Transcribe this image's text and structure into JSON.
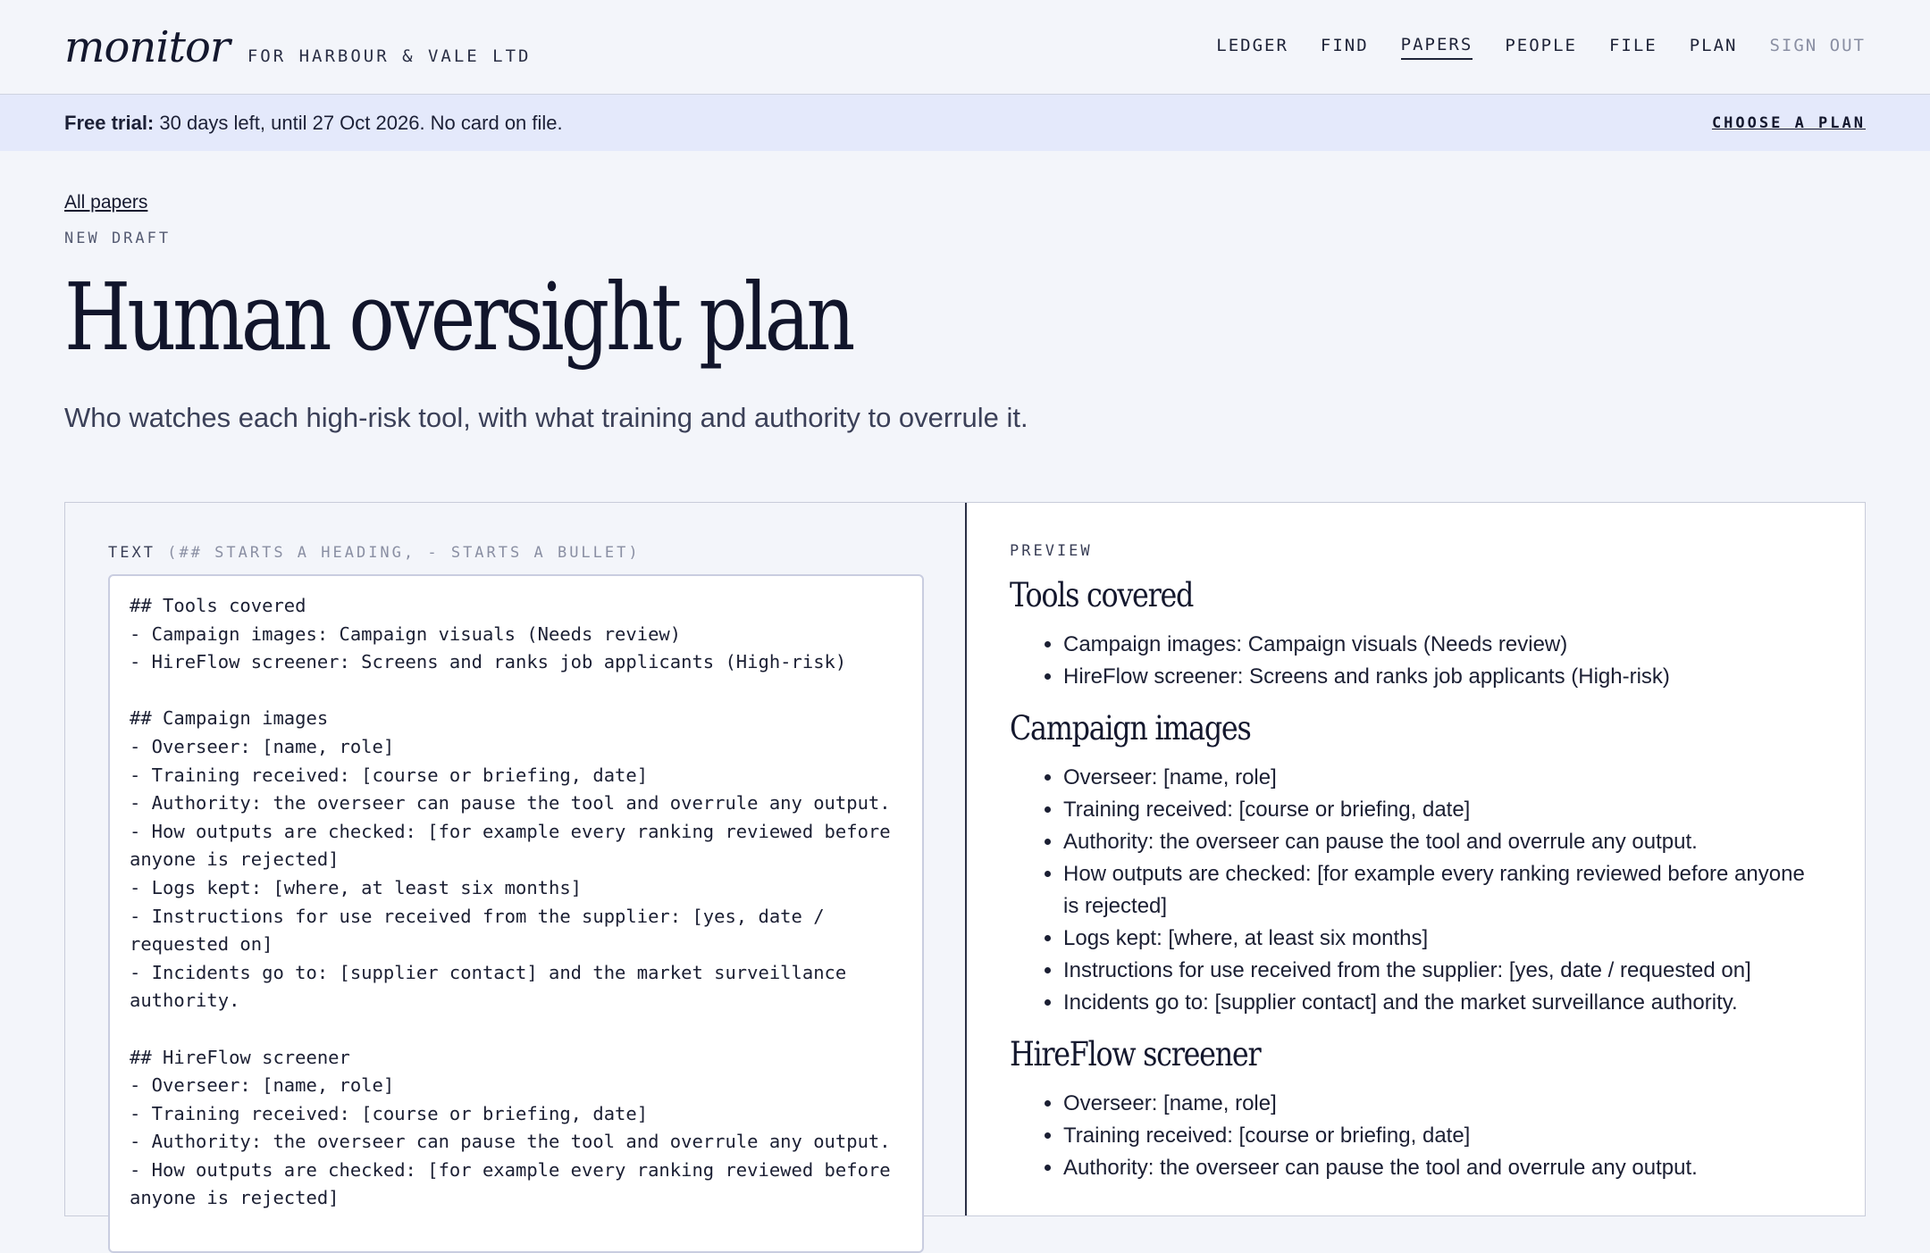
{
  "header": {
    "logo": "monitor",
    "client": "FOR HARBOUR & VALE LTD",
    "nav": [
      {
        "label": "LEDGER"
      },
      {
        "label": "FIND"
      },
      {
        "label": "PAPERS"
      },
      {
        "label": "PEOPLE"
      },
      {
        "label": "FILE"
      },
      {
        "label": "PLAN"
      },
      {
        "label": "SIGN OUT"
      }
    ],
    "active_nav": "PAPERS"
  },
  "trial_banner": {
    "label": "Free trial:",
    "text": " 30 days left, until 27 Oct 2026. No card on file.",
    "cta": "CHOOSE A PLAN"
  },
  "page": {
    "back_link": "All papers",
    "eyebrow": "NEW DRAFT",
    "title": "Human oversight plan",
    "subtitle": "Who watches each high-risk tool, with what training and authority to overrule it."
  },
  "editor": {
    "label": "TEXT",
    "hint": "(## STARTS A HEADING, - STARTS A BULLET)",
    "text": "## Tools covered\n- Campaign images: Campaign visuals (Needs review)\n- HireFlow screener: Screens and ranks job applicants (High-risk)\n\n## Campaign images\n- Overseer: [name, role]\n- Training received: [course or briefing, date]\n- Authority: the overseer can pause the tool and overrule any output.\n- How outputs are checked: [for example every ranking reviewed before anyone is rejected]\n- Logs kept: [where, at least six months]\n- Instructions for use received from the supplier: [yes, date / requested on]\n- Incidents go to: [supplier contact] and the market surveillance authority.\n\n## HireFlow screener\n- Overseer: [name, role]\n- Training received: [course or briefing, date]\n- Authority: the overseer can pause the tool and overrule any output.\n- How outputs are checked: [for example every ranking reviewed before anyone is rejected]"
  },
  "preview": {
    "label": "PREVIEW",
    "sections": [
      {
        "heading": "Tools covered",
        "items": [
          "Campaign images: Campaign visuals (Needs review)",
          "HireFlow screener: Screens and ranks job applicants (High-risk)"
        ]
      },
      {
        "heading": "Campaign images",
        "items": [
          "Overseer: [name, role]",
          "Training received: [course or briefing, date]",
          "Authority: the overseer can pause the tool and overrule any output.",
          "How outputs are checked: [for example every ranking reviewed before anyone is rejected]",
          "Logs kept: [where, at least six months]",
          "Instructions for use received from the supplier: [yes, date / requested on]",
          "Incidents go to: [supplier contact] and the market surveillance authority."
        ]
      },
      {
        "heading": "HireFlow screener",
        "items": [
          "Overseer: [name, role]",
          "Training received: [course or briefing, date]",
          "Authority: the overseer can pause the tool and overrule any output."
        ]
      }
    ]
  }
}
